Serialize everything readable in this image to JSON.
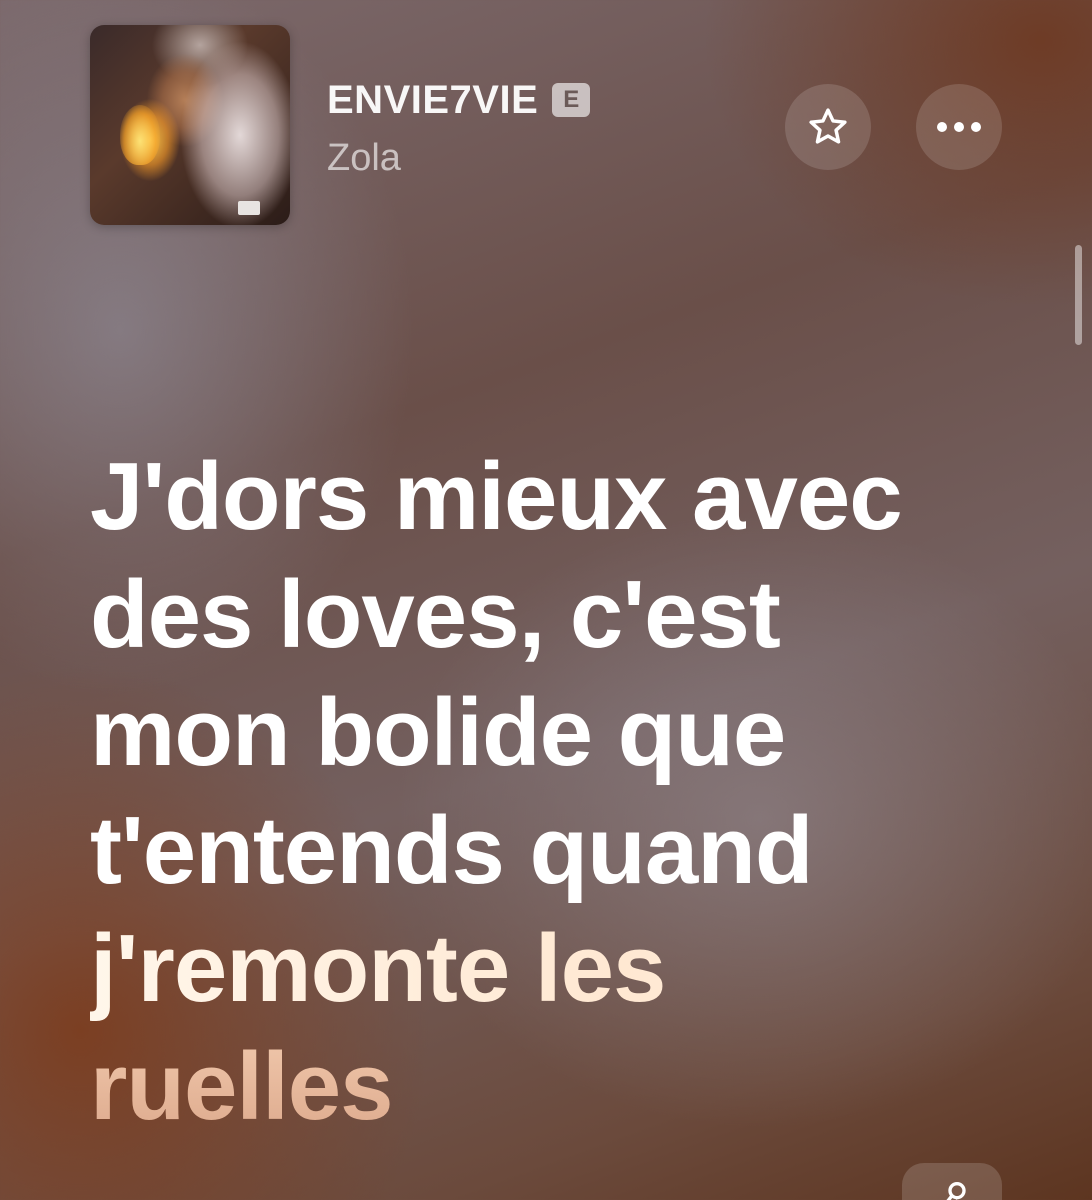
{
  "header": {
    "track_title": "ENVIE7VIE",
    "explicit_label": "E",
    "artist": "Zola",
    "artwork_icon": "album-art",
    "favorite_icon": "star-icon",
    "more_icon": "ellipsis-icon"
  },
  "lyrics": {
    "lines": [
      "J'dors mieux avec",
      "des loves, c'est",
      "mon bolide que",
      "t'entends quand",
      "j'remonte les",
      "ruelles"
    ],
    "active_color": "#ffffff",
    "upcoming_color": "#dca88b"
  },
  "colors": {
    "background_top": "#7c6a6d",
    "background_bottom": "#5d3520"
  },
  "footer": {
    "bottom_button_icon": "microphone-icon"
  }
}
